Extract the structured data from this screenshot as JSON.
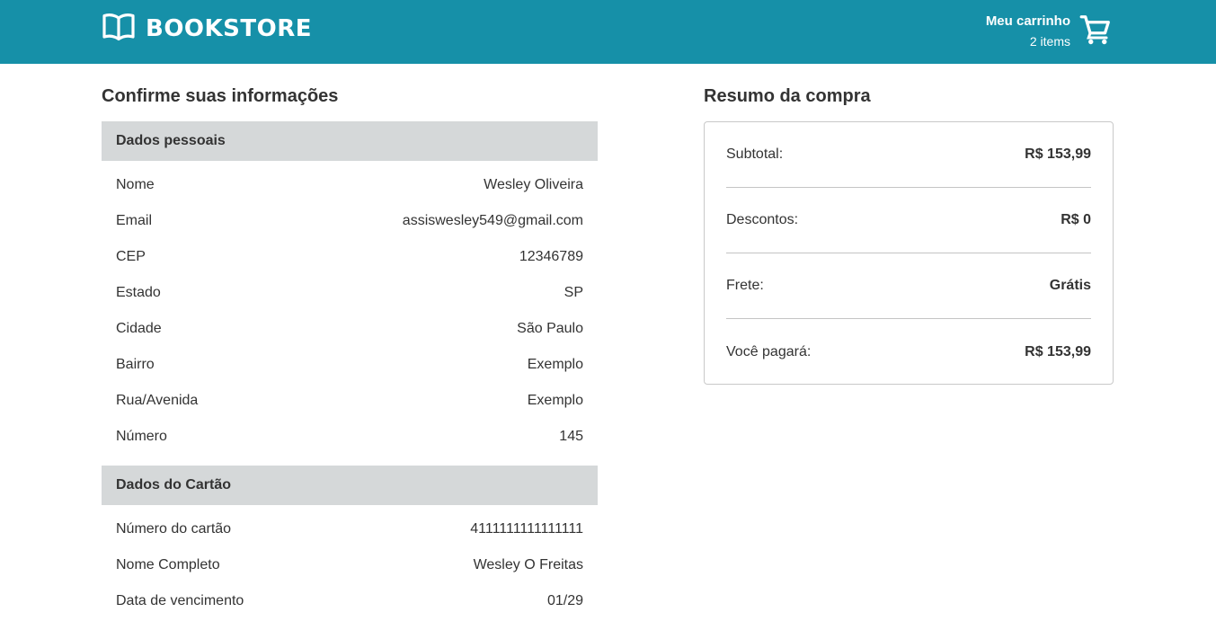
{
  "header": {
    "brand": "BOOKSTORE",
    "brand_icon": "book-icon",
    "cart_title": "Meu carrinho",
    "cart_count": "2 items",
    "cart_icon": "cart-icon",
    "bg_color": "#1690a8"
  },
  "confirm": {
    "title": "Confirme suas informações",
    "personal": {
      "heading": "Dados pessoais",
      "rows": [
        {
          "label": "Nome",
          "value": "Wesley Oliveira"
        },
        {
          "label": "Email",
          "value": "assiswesley549@gmail.com"
        },
        {
          "label": "CEP",
          "value": "12346789"
        },
        {
          "label": "Estado",
          "value": "SP"
        },
        {
          "label": "Cidade",
          "value": "São Paulo"
        },
        {
          "label": "Bairro",
          "value": "Exemplo"
        },
        {
          "label": "Rua/Avenida",
          "value": "Exemplo"
        },
        {
          "label": "Número",
          "value": "145"
        }
      ]
    },
    "card": {
      "heading": "Dados do Cartão",
      "rows": [
        {
          "label": "Número do cartão",
          "value": "4111111111111111"
        },
        {
          "label": "Nome Completo",
          "value": "Wesley O Freitas"
        },
        {
          "label": "Data de vencimento",
          "value": "01/29"
        }
      ]
    }
  },
  "summary": {
    "title": "Resumo da compra",
    "rows": [
      {
        "label": "Subtotal:",
        "value": "R$ 153,99"
      },
      {
        "label": "Descontos:",
        "value": "R$ 0"
      },
      {
        "label": "Frete:",
        "value": "Grátis"
      },
      {
        "label": "Você pagará:",
        "value": "R$ 153,99"
      }
    ]
  }
}
